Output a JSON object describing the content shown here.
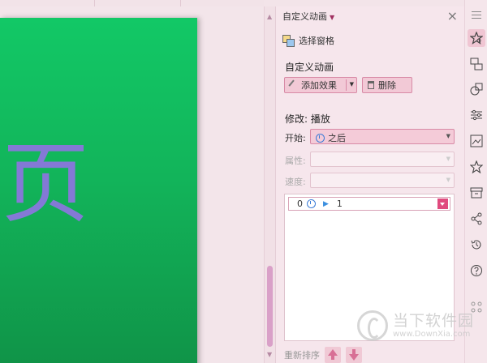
{
  "slide": {
    "visible_char": "页"
  },
  "pane": {
    "title": "自定义动画",
    "selection_pane_label": "选择窗格",
    "section_title": "自定义动画",
    "add_effect_label": "添加效果",
    "delete_label": "删除",
    "modify_label": "修改: 播放",
    "start_label": "开始:",
    "start_value": "之后",
    "property_label": "属性:",
    "speed_label": "速度:",
    "list_items": [
      {
        "index": "0",
        "name": "1"
      }
    ],
    "reorder_label": "重新排序"
  },
  "watermark": {
    "cn": "当下软件园",
    "en": "www.DownXia.com"
  },
  "colors": {
    "slide_green": "#12c866",
    "slide_text": "#8479d6",
    "accent_pink": "#e04a7e",
    "pane_bg": "#f6e6ec"
  },
  "rail_icons": [
    "menu-icon",
    "animation-icon",
    "slide-switch-icon",
    "shapes-icon",
    "settings-sliders-icon",
    "save-image-icon",
    "star-icon",
    "archive-icon",
    "share-icon",
    "history-icon",
    "help-icon",
    "grid-icon"
  ]
}
